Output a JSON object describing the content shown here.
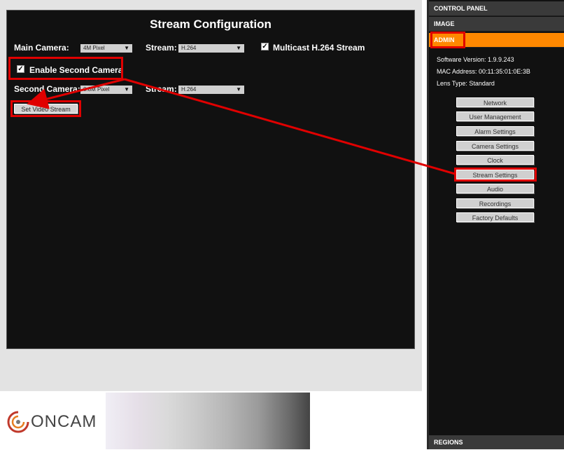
{
  "stream": {
    "title": "Stream Configuration",
    "main_camera_label": "Main Camera:",
    "main_camera_value": "4M Pixel",
    "stream_label": "Stream:",
    "main_stream_value": "H.264",
    "multicast_label": "Multicast H.264 Stream",
    "multicast_checked": true,
    "enable_second_label": "Enable Second Camera",
    "enable_second_checked": true,
    "second_camera_label": "Second Camera:",
    "second_camera_value": "0.8M Pixel",
    "second_stream_label": "Stream:",
    "second_stream_value": "H.264",
    "set_button": "Set Video Stream"
  },
  "nav": {
    "control_panel": "CONTROL PANEL",
    "image": "IMAGE",
    "admin": "ADMIN",
    "regions": "REGIONS"
  },
  "info": {
    "software_version": "Software Version:  1.9.9.243",
    "mac_address": "MAC Address:  00:11:35:01:0E:3B",
    "lens_type": "Lens Type:  Standard"
  },
  "admin_buttons": [
    "Network",
    "User Management",
    "Alarm Settings",
    "Camera Settings",
    "Clock",
    "Stream Settings",
    "Audio",
    "Recordings",
    "Factory Defaults"
  ],
  "brand": {
    "logo_text": "ONCAM"
  },
  "colors": {
    "annotation_red": "#e00000",
    "admin_orange": "#ff8800",
    "panel_bg": "#111111"
  }
}
